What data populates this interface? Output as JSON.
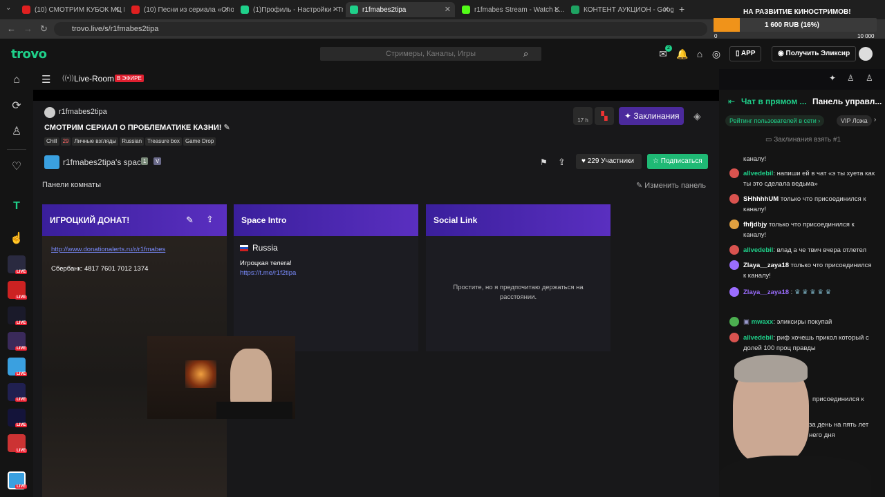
{
  "browser": {
    "tabs": [
      {
        "label": "(10) СМОТРИМ КУБОК МЦ LA...",
        "color": "#e02020"
      },
      {
        "label": "(10) Песни из сериала «Слово...",
        "color": "#e02020"
      },
      {
        "label": "(1)Профиль - Настройки - Tro...",
        "color": "#1fd08a"
      },
      {
        "label": "r1fmabes2tipa",
        "color": "#1fd08a"
      },
      {
        "label": "r1fmabes Stream - Watch L...",
        "color": "#53fc18"
      },
      {
        "label": "КОНТЕНТ АУКЦИОН - Google...",
        "color": "#1ea362"
      }
    ],
    "url": "trovo.live/s/r1fmabes2tipa"
  },
  "donation_widget": {
    "title": "НА РАЗВИТИЕ КИНОСТРИМОВ!",
    "amount": "1 600 RUB (16%)",
    "min": "0",
    "max": "10 000",
    "progress": 0.16
  },
  "header": {
    "logo": "trovo",
    "search_placeholder": "Стримеры, Каналы, Игры",
    "app_label": "APP",
    "elixir_label": "Получить Эликсир",
    "notif_badge": "2"
  },
  "subheader": {
    "liveroom": "Live-Room",
    "live_badge": "В ЭФИРЕ"
  },
  "stream": {
    "streamer": "r1fmabes2tipa",
    "title": "СМОТРИМ СЕРИАЛ О ПРОБЛЕМАТИКЕ КАЗНИ!",
    "tags": [
      "Chill",
      "29",
      "Личные взгляды",
      "Russian",
      "Treasure box",
      "Game Drop"
    ],
    "space": "r1fmabes2tipa's space",
    "space_badges": [
      "1",
      "V"
    ],
    "participants": "229 Участники",
    "subscribe": "Подписаться",
    "spells": "Заклинания",
    "timer": "17 h"
  },
  "panels": {
    "section_title": "Панели комнаты",
    "edit_label": "Изменить панель",
    "items": [
      {
        "title": "ИГРОЦКИЙ ДОНАТ!",
        "link": "http://www.donationalerts.ru/r/r1fmabes",
        "text": "Сбербанк: 4817 7601 7012 1374"
      },
      {
        "title": "Space Intro",
        "country": "Russia",
        "text": "Игроцкая телега!",
        "link": "https://t.me/r1f2tipa"
      },
      {
        "title": "Social Link",
        "text": "Простите, но я предпочитаю держаться на расстоянии."
      }
    ]
  },
  "chat": {
    "tab1": "Чат в прямом ...",
    "tab2": "Панель управл...",
    "ranking": "Рейтинг пользователей в сети",
    "vip": "VIP Ложа",
    "spell_note": "Заклинания взять #1",
    "messages": [
      {
        "name": "",
        "text": "каналу!",
        "color": "#d9534f"
      },
      {
        "name": "allvedebil",
        "text": ": напиши ей в чат «э ты хуета как ты это сделала ведьма»",
        "color": "#1fd08a"
      },
      {
        "name": "SHhhhhUM",
        "text": " только что присоединился к каналу!",
        "color": "#fff"
      },
      {
        "name": "fhfjdbjy",
        "text": " только что присоединился к каналу!",
        "color": "#fff"
      },
      {
        "name": "allvedebil",
        "text": ": влад а че твич вчера отлетел",
        "color": "#1fd08a"
      },
      {
        "name": "Zlaya__zaya18",
        "text": " только что присоединился к каналу!",
        "color": "#fff"
      },
      {
        "name": "Zlaya__zaya18",
        "text": " :",
        "color": "#9b6dff"
      },
      {
        "name": "mwaxx",
        "text": ": эликсиры покупай",
        "color": "#1fd08a"
      },
      {
        "name": "allvedebil",
        "text": ": риф хочешь прикол который с долей 100 проц правды",
        "color": "#1fd08a"
      },
      {
        "name": "",
        "text": "присоединился к",
        "color": "#fff"
      },
      {
        "name": "",
        "text": "за день на пять лет",
        "color": "#fff"
      },
      {
        "name": "",
        "text": "него дня",
        "color": "#fff"
      }
    ]
  }
}
